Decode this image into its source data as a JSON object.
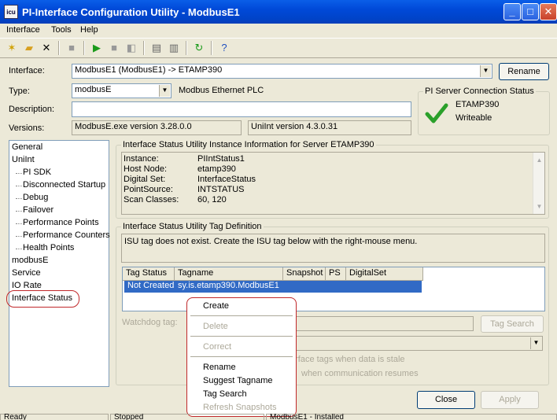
{
  "window": {
    "title": "PI-Interface Configuration Utility - ModbusE1",
    "icon_text": "icu",
    "controls": {
      "minimize": "_",
      "maximize": "□",
      "close": "✕"
    }
  },
  "menu": [
    "Interface",
    "Tools",
    "Help"
  ],
  "form": {
    "interface_label": "Interface:",
    "interface_value": "ModbusE1 (ModbusE1) -> ETAMP390",
    "rename_label": "Rename",
    "type_label": "Type:",
    "type_value": "modbusE",
    "type_desc": "Modbus Ethernet PLC",
    "description_label": "Description:",
    "description_value": "",
    "versions_label": "Versions:",
    "version_exe": "ModbusE.exe version 3.28.0.0",
    "version_uniint": "UniInt version 4.3.0.31"
  },
  "pi_server": {
    "group_title": "PI Server Connection Status",
    "server": "ETAMP390",
    "status": "Writeable"
  },
  "tree": [
    {
      "label": "General",
      "indent": 0
    },
    {
      "label": "UniInt",
      "indent": 0
    },
    {
      "label": "PI SDK",
      "indent": 1
    },
    {
      "label": "Disconnected Startup",
      "indent": 1
    },
    {
      "label": "Debug",
      "indent": 1
    },
    {
      "label": "Failover",
      "indent": 1
    },
    {
      "label": "Performance Points",
      "indent": 1
    },
    {
      "label": "Performance Counters",
      "indent": 1
    },
    {
      "label": "Health Points",
      "indent": 1
    },
    {
      "label": "modbusE",
      "indent": 0
    },
    {
      "label": "Service",
      "indent": 0
    },
    {
      "label": "IO Rate",
      "indent": 0
    },
    {
      "label": "Interface Status",
      "indent": 0
    }
  ],
  "isu_info": {
    "group_title": "Interface Status Utility Instance Information for Server ETAMP390",
    "rows": [
      {
        "key": "Instance:",
        "value": "PIIntStatus1"
      },
      {
        "key": "Host Node:",
        "value": "etamp390"
      },
      {
        "key": "Digital Set:",
        "value": "InterfaceStatus"
      },
      {
        "key": "PointSource:",
        "value": "INTSTATUS"
      },
      {
        "key": "Scan Classes:",
        "value": "60, 120"
      }
    ]
  },
  "isu_tag": {
    "group_title": "Interface Status Utility Tag Definition",
    "message": "ISU tag does not exist.  Create the ISU tag below with the right-mouse menu.",
    "columns": [
      "Tag Status",
      "Tagname",
      "Snapshot",
      "PS",
      "DigitalSet"
    ],
    "row": {
      "status": "Not Created",
      "tagname": "sy.is.etamp390.ModbusE1"
    },
    "watchdog_label": "Watchdog tag:",
    "tag_search_label": "Tag Search",
    "stale_text": "erface tags when data is stale",
    "resume_text": "when communication resumes"
  },
  "context_menu": [
    {
      "label": "Create",
      "enabled": true
    },
    {
      "label": "Delete",
      "enabled": false
    },
    {
      "label": "Correct",
      "enabled": false
    },
    {
      "label": "Rename",
      "enabled": true
    },
    {
      "label": "Suggest Tagname",
      "enabled": true
    },
    {
      "label": "Tag Search",
      "enabled": true
    },
    {
      "label": "Refresh Snapshots",
      "enabled": false
    }
  ],
  "buttons": {
    "close": "Close",
    "apply": "Apply"
  },
  "statusbar": {
    "ready": "Ready",
    "stopped": "Stopped",
    "installed": "ModbusE1 - Installed"
  },
  "colors": {
    "title_blue": "#0049d8",
    "highlight": "#316ac5",
    "callout_red": "#c0282a",
    "check_green": "#2aa02a"
  }
}
